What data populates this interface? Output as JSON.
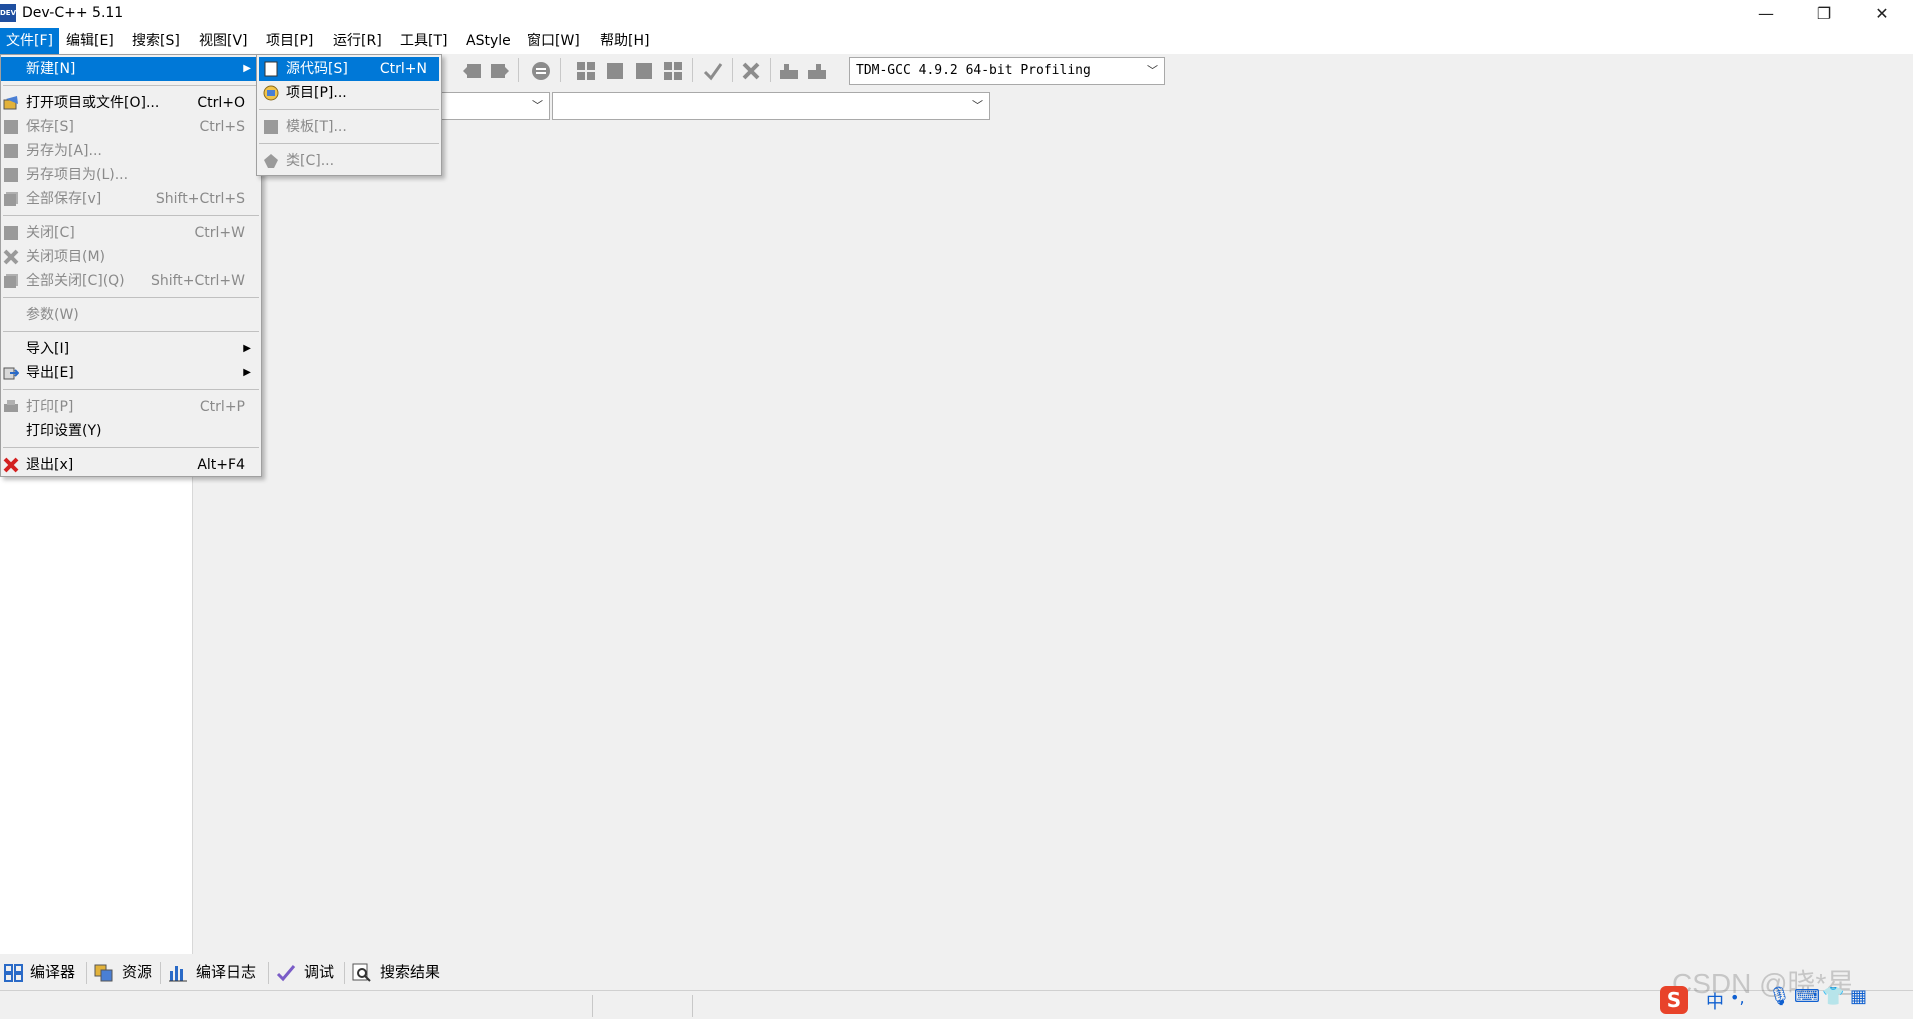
{
  "window": {
    "title": "Dev-C++ 5.11",
    "app_icon_text": "DEV",
    "minimize": "—",
    "maximize": "❐",
    "close": "✕"
  },
  "menubar": {
    "items": [
      "文件[F]",
      "编辑[E]",
      "搜索[S]",
      "视图[V]",
      "项目[P]",
      "运行[R]",
      "工具[T]",
      "AStyle",
      "窗口[W]",
      "帮助[H]"
    ]
  },
  "toolbar": {
    "compiler": "TDM-GCC 4.9.2 64-bit Profiling"
  },
  "file_menu": {
    "items": [
      {
        "label": "新建[N]",
        "shortcut": "",
        "disabled": false,
        "submenu": true,
        "icon": "none"
      },
      {
        "label": "打开项目或文件[O]...",
        "shortcut": "Ctrl+O",
        "disabled": false,
        "icon": "open-folder-icon"
      },
      {
        "label": "保存[S]",
        "shortcut": "Ctrl+S",
        "disabled": true,
        "icon": "save-icon"
      },
      {
        "label": "另存为[A]...",
        "shortcut": "",
        "disabled": true,
        "icon": "save-as-icon"
      },
      {
        "label": "另存项目为(L)...",
        "shortcut": "",
        "disabled": true,
        "icon": "save-project-icon"
      },
      {
        "label": "全部保存[v]",
        "shortcut": "Shift+Ctrl+S",
        "disabled": true,
        "icon": "save-all-icon"
      },
      {
        "label": "关闭[C]",
        "shortcut": "Ctrl+W",
        "disabled": true,
        "icon": "close-file-icon"
      },
      {
        "label": "关闭项目(M)",
        "shortcut": "",
        "disabled": true,
        "icon": "close-project-icon"
      },
      {
        "label": "全部关闭[C](Q)",
        "shortcut": "Shift+Ctrl+W",
        "disabled": true,
        "icon": "close-all-icon"
      },
      {
        "label": "参数(W)",
        "shortcut": "",
        "disabled": true,
        "icon": "none"
      },
      {
        "label": "导入[I]",
        "shortcut": "",
        "disabled": false,
        "submenu": true,
        "icon": "none"
      },
      {
        "label": "导出[E]",
        "shortcut": "",
        "disabled": false,
        "submenu": true,
        "icon": "export-icon"
      },
      {
        "label": "打印[P]",
        "shortcut": "Ctrl+P",
        "disabled": true,
        "icon": "print-icon"
      },
      {
        "label": "打印设置(Y)",
        "shortcut": "",
        "disabled": false,
        "icon": "none"
      },
      {
        "label": "退出[x]",
        "shortcut": "Alt+F4",
        "disabled": false,
        "icon": "exit-icon"
      }
    ]
  },
  "new_submenu": {
    "items": [
      {
        "label": "源代码[S]",
        "shortcut": "Ctrl+N",
        "disabled": false,
        "icon": "source-file-icon"
      },
      {
        "label": "项目[P]...",
        "shortcut": "",
        "disabled": false,
        "icon": "project-icon"
      },
      {
        "label": "模板[T]...",
        "shortcut": "",
        "disabled": true,
        "icon": "template-icon"
      },
      {
        "label": "类[C]...",
        "shortcut": "",
        "disabled": true,
        "icon": "class-icon"
      }
    ]
  },
  "bottom_tabs": [
    "编译器",
    "资源",
    "编译日志",
    "调试",
    "搜索结果"
  ],
  "watermark": "CSDN @晓*星",
  "ime": {
    "lang": "中"
  },
  "colors": {
    "accent": "#0078d7",
    "disabled_text": "#8a8a8a",
    "exit_red": "#d32020"
  }
}
